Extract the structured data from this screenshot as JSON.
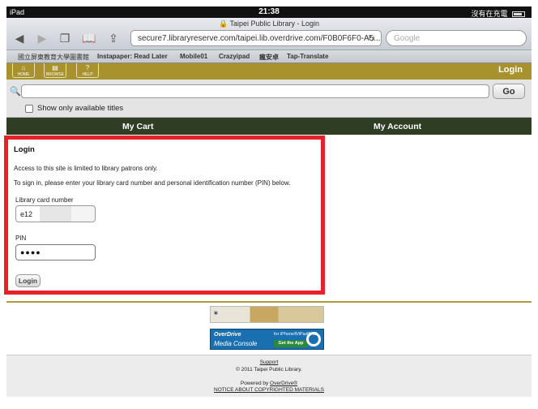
{
  "status_bar": {
    "device": "iPad",
    "time": "21:38",
    "charging_text": "沒有在充電"
  },
  "browser": {
    "page_title": "Taipei Public Library - Login",
    "url": "secure7.libraryreserve.com/taipei.lib.overdrive.com/F0B0F6F0-A5...",
    "search_placeholder": "Google"
  },
  "bookmarks": [
    "國立屏東教育大學圖書館",
    "Instapaper: Read Later",
    "Mobile01",
    "Crazyipad",
    "瘋安卓",
    "Tap-Translate"
  ],
  "site_header": {
    "home_label": "HOME",
    "browse_label": "BROWSE",
    "help_label": "HELP",
    "login_link": "Login"
  },
  "site_search": {
    "go_label": "Go",
    "available_only_label": "Show only available titles"
  },
  "nav": {
    "cart": "My Cart",
    "account": "My Account"
  },
  "login": {
    "title": "Login",
    "notice": "Access to this site is limited to library patrons only.",
    "instructions": "To sign in, please enter your library card number and personal identification number (PIN) below.",
    "card_label": "Library card number",
    "card_value": "e12",
    "pin_label": "PIN",
    "pin_value": "●●●●",
    "button": "Login"
  },
  "banners": {
    "media_console_brand": "OverDrive",
    "media_console_name": "Media Console",
    "media_console_devices": "for iPhone®/iPad® v2",
    "get_app": "Get the App"
  },
  "footer": {
    "support": "Support",
    "copyright": "© 2011 Taipei Public Library.",
    "powered_prefix": "Powered by ",
    "powered_link": "OverDrive®",
    "notice": "NOTICE ABOUT COPYRIGHTED MATERIALS"
  },
  "colors": {
    "header_gold": "#a8922e",
    "nav_green": "#2f3d24",
    "highlight_red": "#e5212a"
  }
}
